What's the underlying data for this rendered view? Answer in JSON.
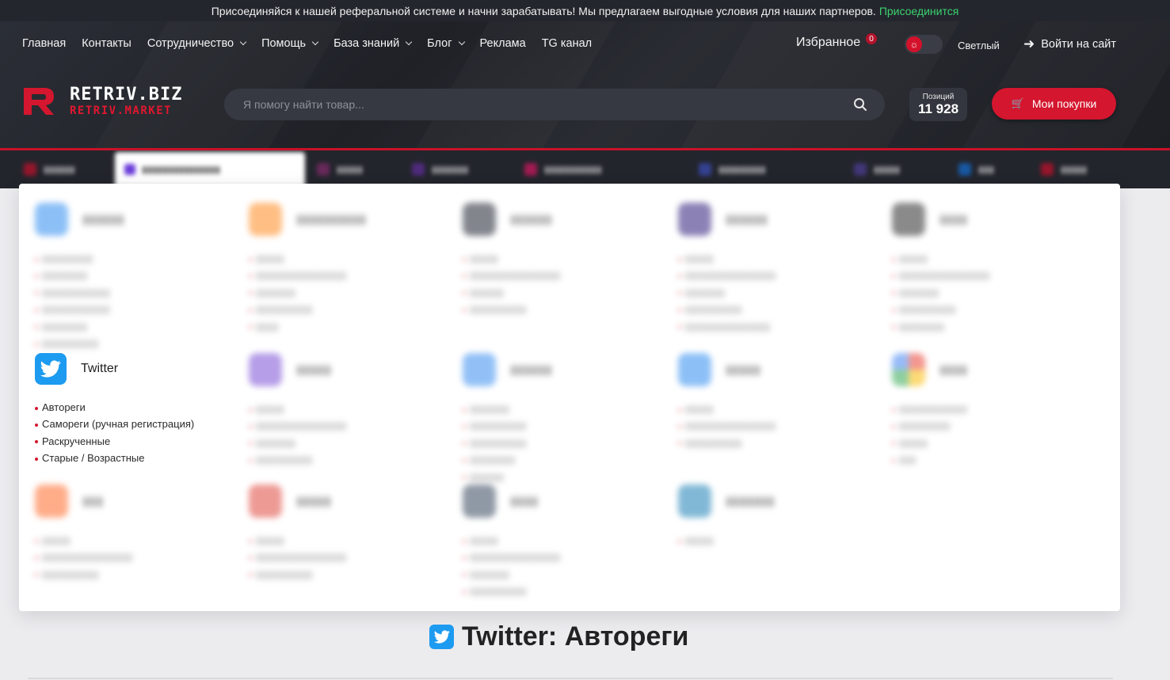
{
  "promo": {
    "text": "Присоединяйся к нашей реферальной системе и начни зарабатывать! Мы предлагаем выгодные условия для наших партнеров.",
    "join_label": "Присоединится"
  },
  "nav": [
    {
      "label": "Главная",
      "dropdown": false
    },
    {
      "label": "Контакты",
      "dropdown": false
    },
    {
      "label": "Сотрудничество",
      "dropdown": true
    },
    {
      "label": "Помощь",
      "dropdown": true
    },
    {
      "label": "База знаний",
      "dropdown": true
    },
    {
      "label": "Блог",
      "dropdown": true
    },
    {
      "label": "Реклама",
      "dropdown": false
    },
    {
      "label": "TG канал",
      "dropdown": false
    }
  ],
  "favorites": {
    "label": "Избранное",
    "count": "0"
  },
  "theme": {
    "label": "Светлый",
    "icon": "sun-icon"
  },
  "login": {
    "label": "Войти на сайт",
    "icon": "arrow-right-icon"
  },
  "logo": {
    "line1": "RETRIV.BIZ",
    "line2": "RETRIV.MARKET"
  },
  "search": {
    "placeholder": "Я помогу найти товар..."
  },
  "positions": {
    "label": "Позиций",
    "value": "11 928"
  },
  "purchases": {
    "label": "Мои покупки",
    "icon": "cart-icon"
  },
  "colors": {
    "accent": "#d4162e",
    "header_bg": "#23252c",
    "twitter": "#1d9bf0",
    "join_link": "#3bd16f"
  },
  "dropdown": {
    "featured": {
      "title": "Twitter",
      "icon": "twitter-icon",
      "items": [
        "Автореги",
        "Самореги (ручная регистрация)",
        "Раскрученные",
        "Старые / Возрастные"
      ]
    }
  },
  "page": {
    "title": "Twitter: Автореги",
    "icon": "twitter-icon"
  }
}
